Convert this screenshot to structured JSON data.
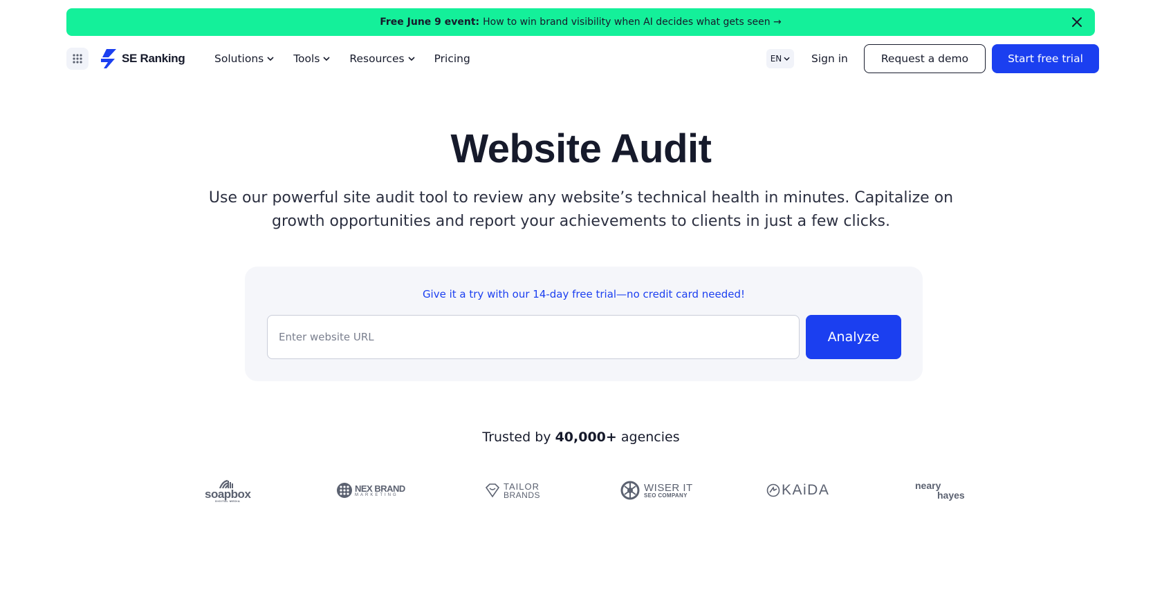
{
  "banner": {
    "bold_text": "Free June 9 event:",
    "text": "How to win brand visibility when AI decides what gets seen →",
    "close_icon": "close-icon"
  },
  "header": {
    "apps_icon": "grid-apps-icon",
    "logo_text": "SE Ranking",
    "nav": [
      {
        "label": "Solutions"
      },
      {
        "label": "Tools"
      },
      {
        "label": "Resources"
      },
      {
        "label": "Pricing"
      }
    ],
    "language": "EN",
    "sign_in": "Sign in",
    "request_demo": "Request a demo",
    "start_trial": "Start free trial"
  },
  "hero": {
    "title": "Website Audit",
    "subtitle": "Use our powerful site audit tool to review any website’s technical health in minutes. Capitalize on growth opportunities and report your achievements to clients in just a few clicks."
  },
  "audit_form": {
    "promo": "Give it a try with our 14-day free trial—no credit card needed!",
    "url_placeholder": "Enter website URL",
    "url_value": "",
    "analyze_label": "Analyze"
  },
  "trusted": {
    "prefix": "Trusted by",
    "count": "40,000+",
    "suffix": "agencies"
  },
  "client_logos": [
    {
      "name": "soapbox",
      "sub": "DIGITAL MEDIA"
    },
    {
      "name": "NEX BRAND",
      "sub": "MARKETING"
    },
    {
      "name": "TAILOR",
      "sub": "BRANDS"
    },
    {
      "name": "WISER IT",
      "sub": "SEO COMPANY"
    },
    {
      "name": "KAiDA",
      "sub": ""
    },
    {
      "name": "neary",
      "sub": "hayes"
    }
  ],
  "colors": {
    "banner_bg": "#14f09a",
    "primary": "#1b3ff0",
    "text": "#161a2b",
    "card_bg": "#f5f6fa"
  }
}
